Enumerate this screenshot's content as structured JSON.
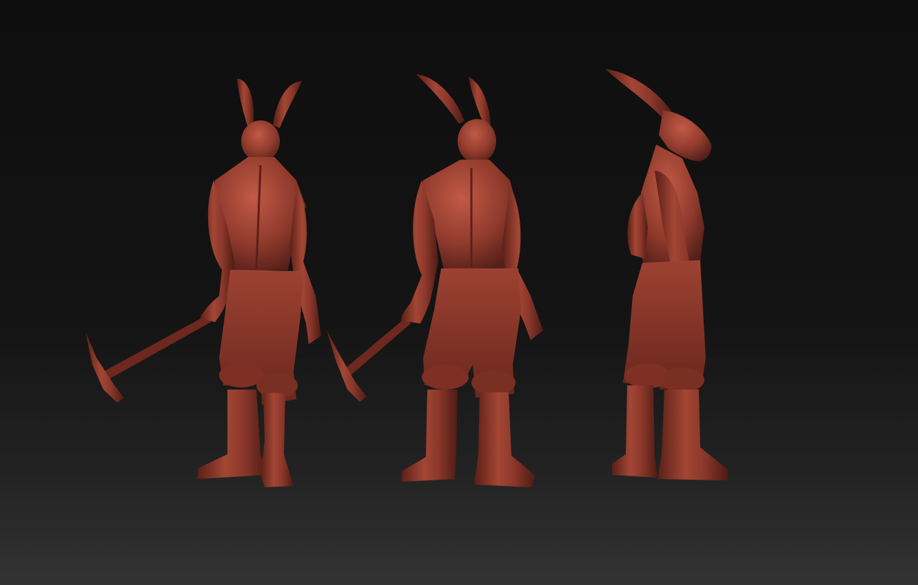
{
  "scene": {
    "views": [
      {
        "view": "back-three-quarter",
        "holds_pickaxe": true
      },
      {
        "view": "back",
        "holds_pickaxe": true
      },
      {
        "view": "side-right",
        "holds_pickaxe": false
      }
    ],
    "colors": {
      "background_top": "#0e0e0e",
      "background_bottom": "#303030",
      "clay_base": "#8a352a",
      "clay_light": "#b24f3e",
      "clay_dark": "#4a1a14"
    }
  }
}
